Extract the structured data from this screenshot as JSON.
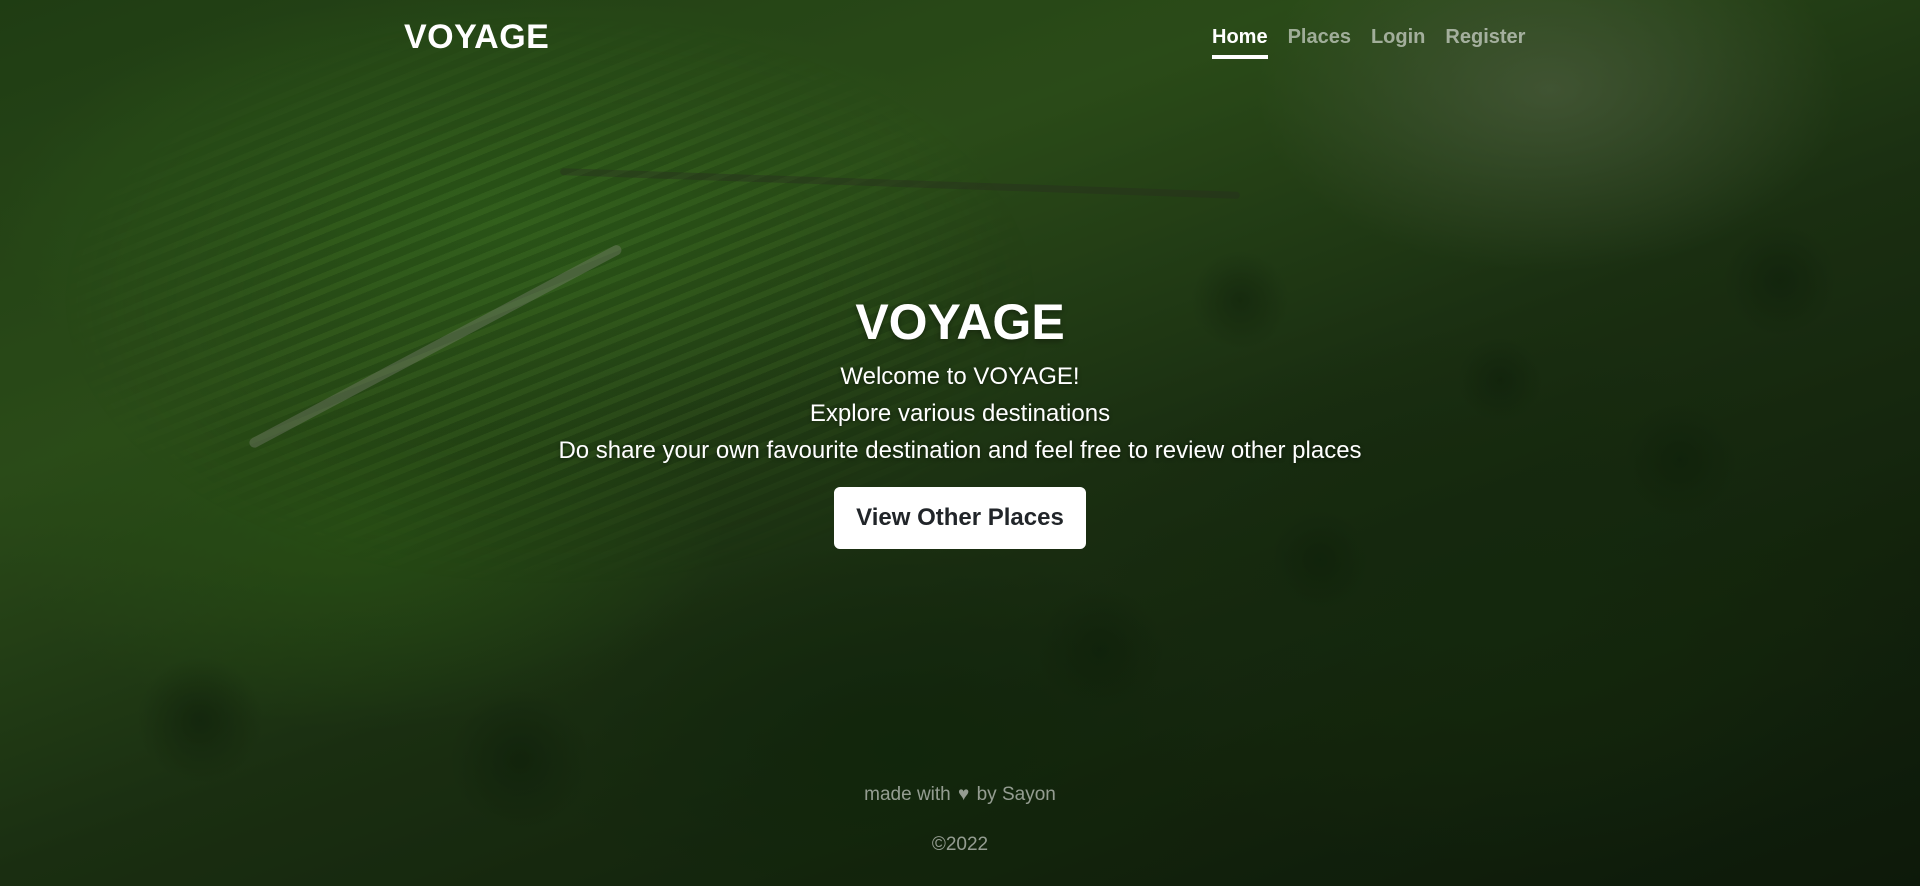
{
  "header": {
    "brand": "VOYAGE",
    "nav": [
      {
        "label": "Home",
        "active": true
      },
      {
        "label": "Places",
        "active": false
      },
      {
        "label": "Login",
        "active": false
      },
      {
        "label": "Register",
        "active": false
      }
    ]
  },
  "hero": {
    "title": "VOYAGE",
    "line1": "Welcome to VOYAGE!",
    "line2": "Explore various destinations",
    "line3": "Do share your own favourite destination and feel free to review other places",
    "cta_label": "View Other Places"
  },
  "footer": {
    "made_prefix": "made with",
    "heart_icon": "♥",
    "made_suffix": "by Sayon",
    "copyright": "©2022"
  },
  "colors": {
    "text": "#ffffff",
    "nav_inactive": "rgba(255,255,255,0.55)",
    "button_bg": "#ffffff",
    "button_text": "#212529"
  }
}
